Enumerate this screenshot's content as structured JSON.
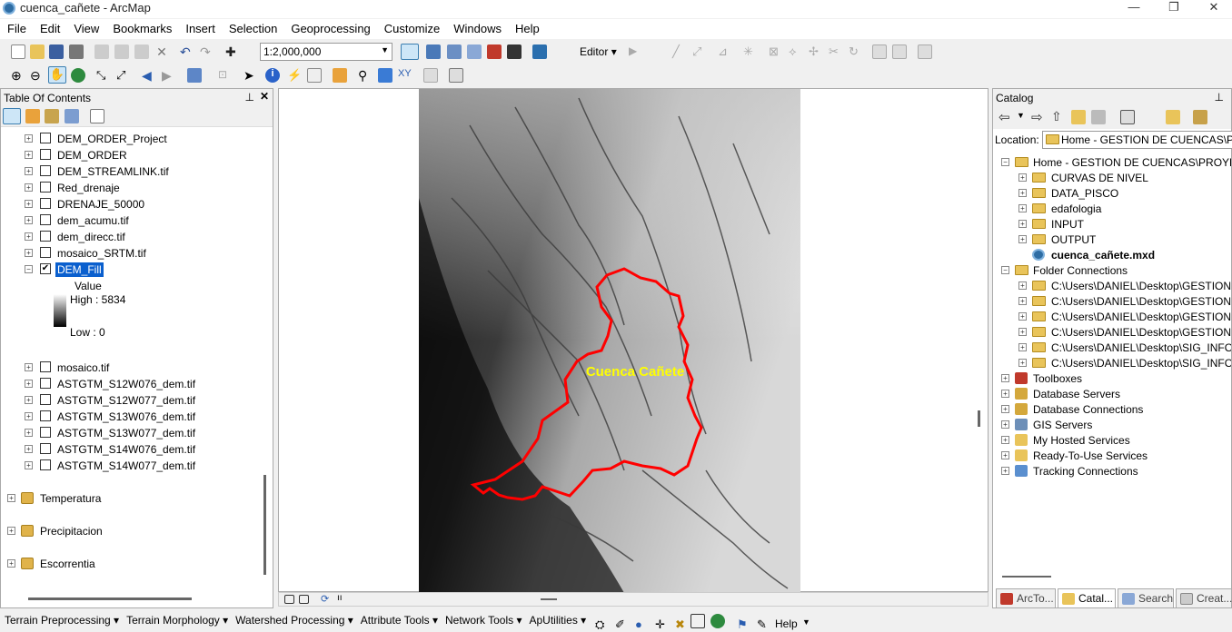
{
  "window": {
    "title": "cuenca_cañete - ArcMap"
  },
  "menu": [
    "File",
    "Edit",
    "View",
    "Bookmarks",
    "Insert",
    "Selection",
    "Geoprocessing",
    "Customize",
    "Windows",
    "Help"
  ],
  "toolbar": {
    "scale": "1:2,000,000",
    "editor_label": "Editor"
  },
  "toc": {
    "title": "Table Of Contents",
    "layers": [
      "DEM_ORDER_Project",
      "DEM_ORDER",
      "DEM_STREAMLINK.tif",
      "Red_drenaje",
      "DRENAJE_50000",
      "dem_acumu.tif",
      "dem_direcc.tif",
      "mosaico_SRTM.tif"
    ],
    "active_layer": "DEM_Fill",
    "legend": {
      "value_label": "Value",
      "high": "High : 5834",
      "low": "Low : 0"
    },
    "layers_after": [
      "mosaico.tif",
      "ASTGTM_S12W076_dem.tif",
      "ASTGTM_S12W077_dem.tif",
      "ASTGTM_S13W076_dem.tif",
      "ASTGTM_S13W077_dem.tif",
      "ASTGTM_S14W076_dem.tif",
      "ASTGTM_S14W077_dem.tif"
    ],
    "groups": [
      "Temperatura",
      "Precipitacion",
      "Escorrentia"
    ]
  },
  "map": {
    "label": "Cuenca Cañete",
    "label_color": "#ffff00",
    "boundary_color": "#ff0000"
  },
  "catalog": {
    "title": "Catalog",
    "location_label": "Location:",
    "location_value": "Home - GESTION DE CUENCAS\\PRO",
    "home": "Home - GESTION DE CUENCAS\\PROYECT",
    "home_children": [
      "CURVAS DE NIVEL",
      "DATA_PISCO",
      "edafologia",
      "INPUT",
      "OUTPUT"
    ],
    "mxd": "cuenca_cañete.mxd",
    "folder_connections": "Folder Connections",
    "connections": [
      "C:\\Users\\DANIEL\\Desktop\\GESTION D",
      "C:\\Users\\DANIEL\\Desktop\\GESTION D",
      "C:\\Users\\DANIEL\\Desktop\\GESTION D",
      "C:\\Users\\DANIEL\\Desktop\\GESTION D",
      "C:\\Users\\DANIEL\\Desktop\\SIG_INFORI",
      "C:\\Users\\DANIEL\\Desktop\\SIG_INFORI"
    ],
    "roots": [
      "Toolboxes",
      "Database Servers",
      "Database Connections",
      "GIS Servers",
      "My Hosted Services",
      "Ready-To-Use Services",
      "Tracking Connections"
    ],
    "tabs": [
      "ArcTo...",
      "Catal...",
      "Search",
      "Creat..."
    ]
  },
  "bottom_toolbar": [
    "Terrain Preprocessing ▾",
    "Terrain Morphology ▾",
    "Watershed Processing ▾",
    "Attribute Tools ▾",
    "Network Tools ▾",
    "ApUtilities ▾"
  ],
  "bottom_help": "Help"
}
